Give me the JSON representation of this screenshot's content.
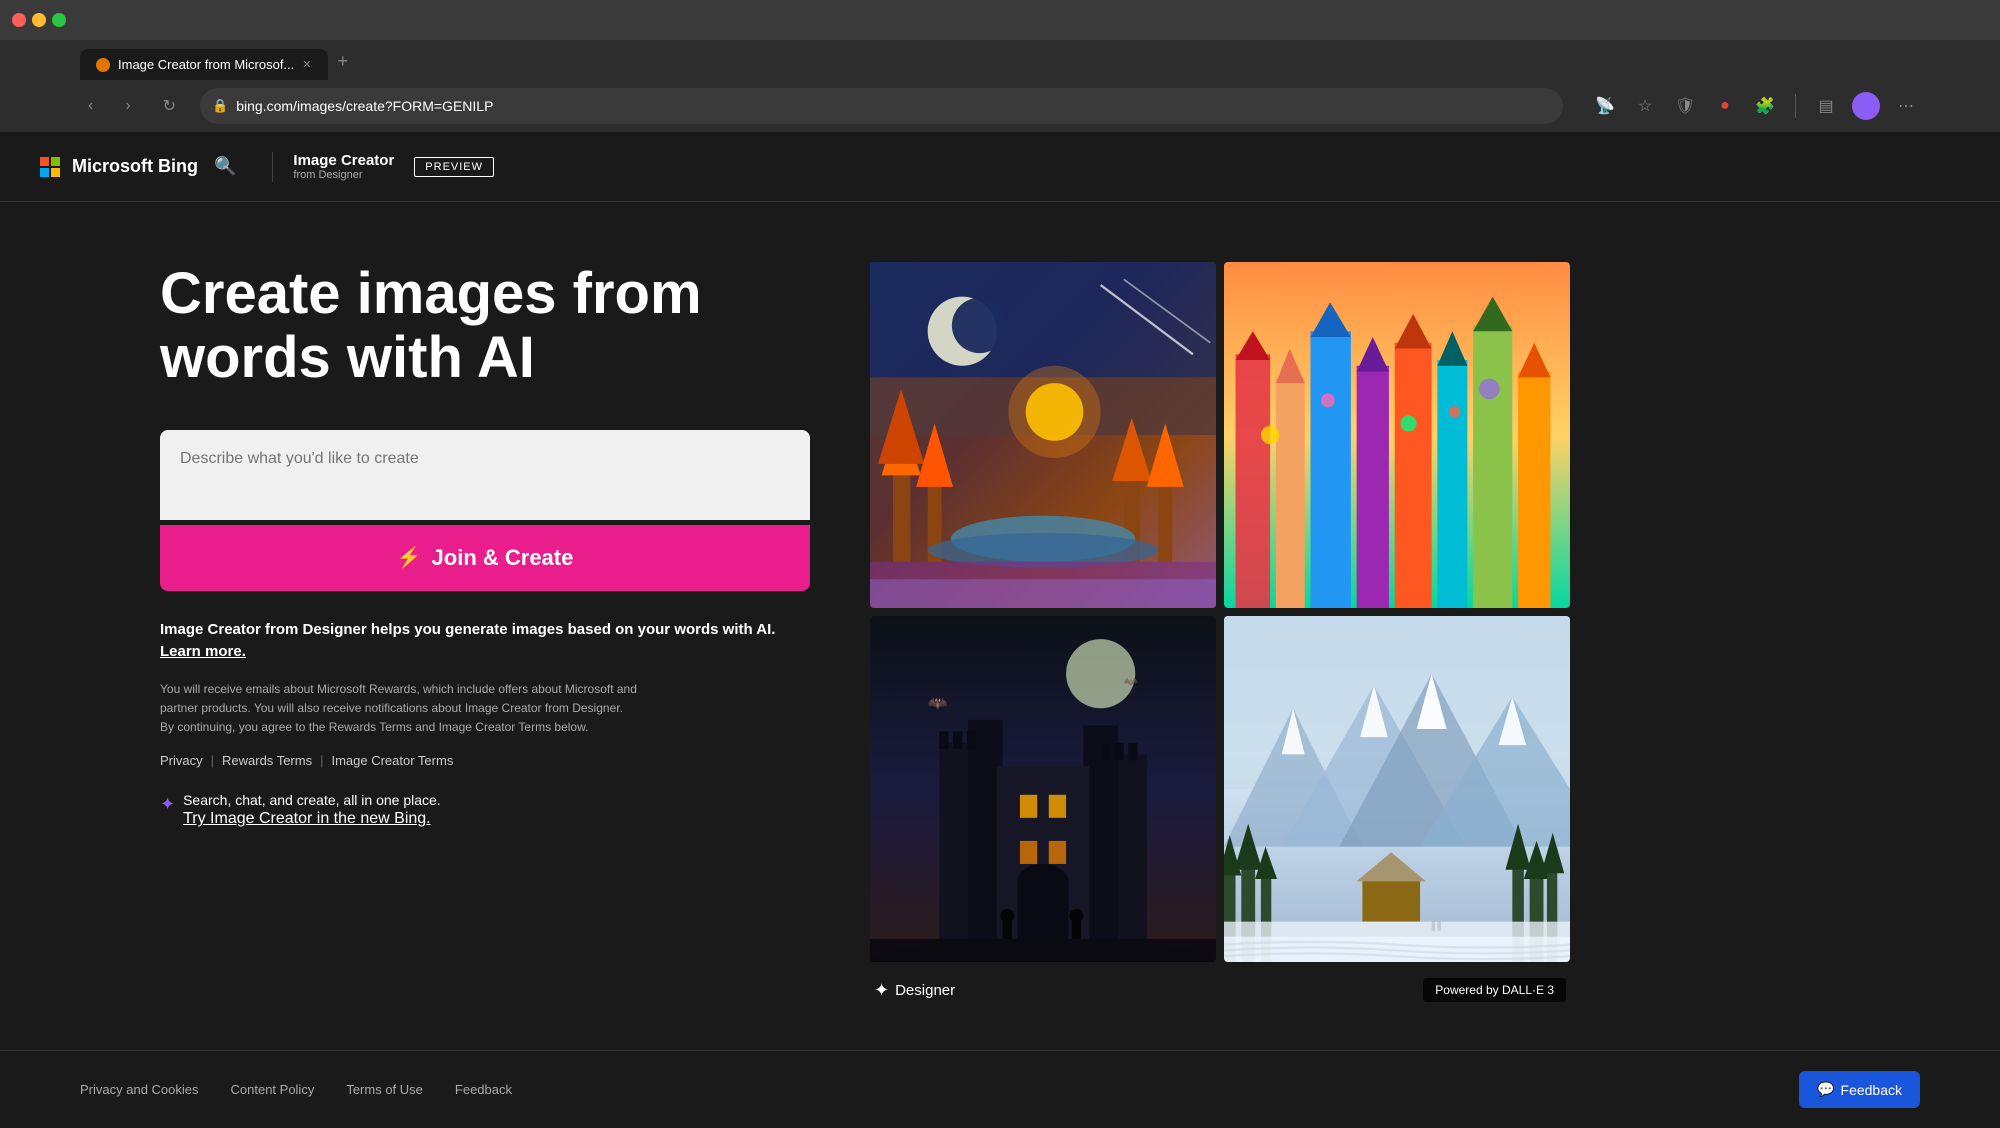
{
  "browser": {
    "url": "bing.com/images/create?FORM=GENILP",
    "tab_title": "Image Creator from Microsof...",
    "traffic_lights": [
      "red",
      "yellow",
      "green"
    ]
  },
  "navbar": {
    "logo_text": "Microsoft Bing",
    "product_title": "Image Creator",
    "product_subtitle": "from Designer",
    "preview_label": "PREVIEW"
  },
  "hero": {
    "title_line1": "Create images from",
    "title_line2": "words with AI"
  },
  "prompt": {
    "placeholder": "Describe what you'd like to create"
  },
  "cta": {
    "join_create_label": "Join & Create"
  },
  "description": {
    "text": "Image Creator from Designer helps you generate images based on your words with AI.",
    "learn_more": "Learn more.",
    "small_print": "You will receive emails about Microsoft Rewards, which include offers about Microsoft and partner products. You will also receive notifications about Image Creator from Designer. By continuing, you agree to the Rewards Terms and Image Creator Terms below."
  },
  "terms": {
    "privacy": "Privacy",
    "rewards": "Rewards Terms",
    "creator": "Image Creator Terms"
  },
  "promo": {
    "text": "Search, chat, and create, all in one place.",
    "link": "Try Image Creator in the new Bing."
  },
  "gallery": {
    "designer_label": "Designer",
    "dalle_badge": "Powered by DALL·E 3"
  },
  "footer": {
    "privacy_cookies": "Privacy and Cookies",
    "content_policy": "Content Policy",
    "terms_of_use": "Terms of Use",
    "feedback": "Feedback",
    "feedback_btn": "Feedback"
  }
}
